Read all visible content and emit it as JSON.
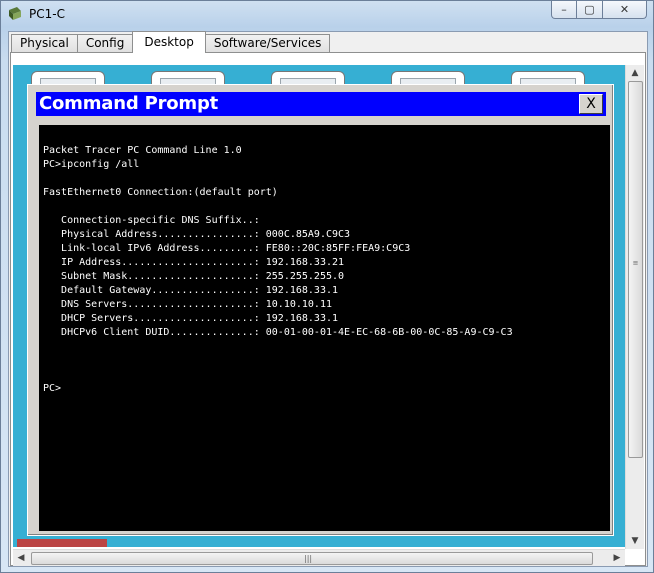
{
  "window": {
    "title": "PC1-C",
    "controls": {
      "minimize": "–",
      "maximize": "▢",
      "close": "✕"
    }
  },
  "tabs": [
    {
      "label": "Physical",
      "active": false
    },
    {
      "label": "Config",
      "active": false
    },
    {
      "label": "Desktop",
      "active": true
    },
    {
      "label": "Software/Services",
      "active": false
    }
  ],
  "command_prompt": {
    "title": "Command Prompt",
    "close_label": "X",
    "lines": [
      "Packet Tracer PC Command Line 1.0",
      "PC>ipconfig /all",
      "",
      "FastEthernet0 Connection:(default port)",
      "",
      "   Connection-specific DNS Suffix..:",
      "   Physical Address................: 000C.85A9.C9C3",
      "   Link-local IPv6 Address.........: FE80::20C:85FF:FEA9:C9C3",
      "   IP Address......................: 192.168.33.21",
      "   Subnet Mask.....................: 255.255.255.0",
      "   Default Gateway.................: 192.168.33.1",
      "   DNS Servers.....................: 10.10.10.11",
      "   DHCP Servers....................: 192.168.33.1",
      "   DHCPv6 Client DUID..............: 00-01-00-01-4E-EC-68-6B-00-0C-85-A9-C9-C3",
      "",
      "",
      "",
      "PC>"
    ]
  },
  "colors": {
    "desktop_bg": "#36afd3",
    "cmd_titlebar": "#0000ff",
    "terminal_bg": "#000000",
    "terminal_fg": "#ffffff"
  },
  "icons": [
    "packet-tracer-app-icon",
    "scroll-up-icon",
    "scroll-down-icon",
    "scroll-left-icon",
    "scroll-right-icon"
  ]
}
